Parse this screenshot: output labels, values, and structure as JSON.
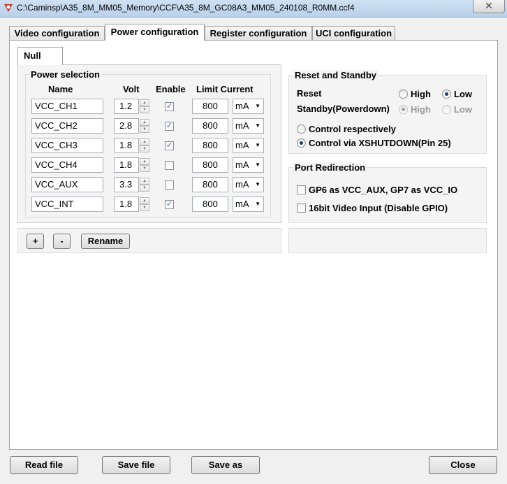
{
  "window": {
    "title": "C:\\Caminsp\\A35_8M_MM05_Memory\\CCF\\A35_8M_GC08A3_MM05_240108_R0MM.ccf4",
    "close_glyph": "✕"
  },
  "tabs": [
    "Video configuration",
    "Power configuration",
    "Register configuration",
    "UCI configuration"
  ],
  "inner_tab": "Null",
  "power_selection": {
    "title": "Power selection",
    "headers": {
      "name": "Name",
      "volt": "Volt",
      "enable": "Enable",
      "limit": "Limit Current"
    },
    "rows": [
      {
        "name": "VCC_CH1",
        "volt": "1.2",
        "enabled": true,
        "limit": "800",
        "unit": "mA"
      },
      {
        "name": "VCC_CH2",
        "volt": "2.8",
        "enabled": true,
        "limit": "800",
        "unit": "mA"
      },
      {
        "name": "VCC_CH3",
        "volt": "1.8",
        "enabled": true,
        "limit": "800",
        "unit": "mA"
      },
      {
        "name": "VCC_CH4",
        "volt": "1.8",
        "enabled": false,
        "limit": "800",
        "unit": "mA"
      },
      {
        "name": "VCC_AUX",
        "volt": "3.3",
        "enabled": false,
        "limit": "800",
        "unit": "mA"
      },
      {
        "name": "VCC_INT",
        "volt": "1.8",
        "enabled": true,
        "limit": "800",
        "unit": "mA"
      }
    ]
  },
  "rail_buttons": {
    "add": "+",
    "remove": "-",
    "rename": "Rename"
  },
  "reset_standby": {
    "title": "Reset and Standby",
    "reset_label": "Reset",
    "standby_label": "Standby(Powerdown)",
    "high": "High",
    "low": "Low",
    "reset_value": "Low",
    "standby_value": "High",
    "control_respectively": "Control respectively",
    "control_xshutdown": "Control via XSHUTDOWN(Pin 25)",
    "control_value": "xshutdown"
  },
  "port_redirection": {
    "title": "Port Redirection",
    "gp6_label": "GP6 as VCC_AUX, GP7 as VCC_IO",
    "gp6_checked": false,
    "video16_label": "16bit Video Input (Disable GPIO)",
    "video16_checked": false
  },
  "footer": {
    "read": "Read file",
    "save": "Save file",
    "save_as": "Save as",
    "close": "Close"
  },
  "colors": {
    "check": "#4a6ca3",
    "radio_dot": "#1b3d6b",
    "titlebar": "#c4d8ee"
  }
}
